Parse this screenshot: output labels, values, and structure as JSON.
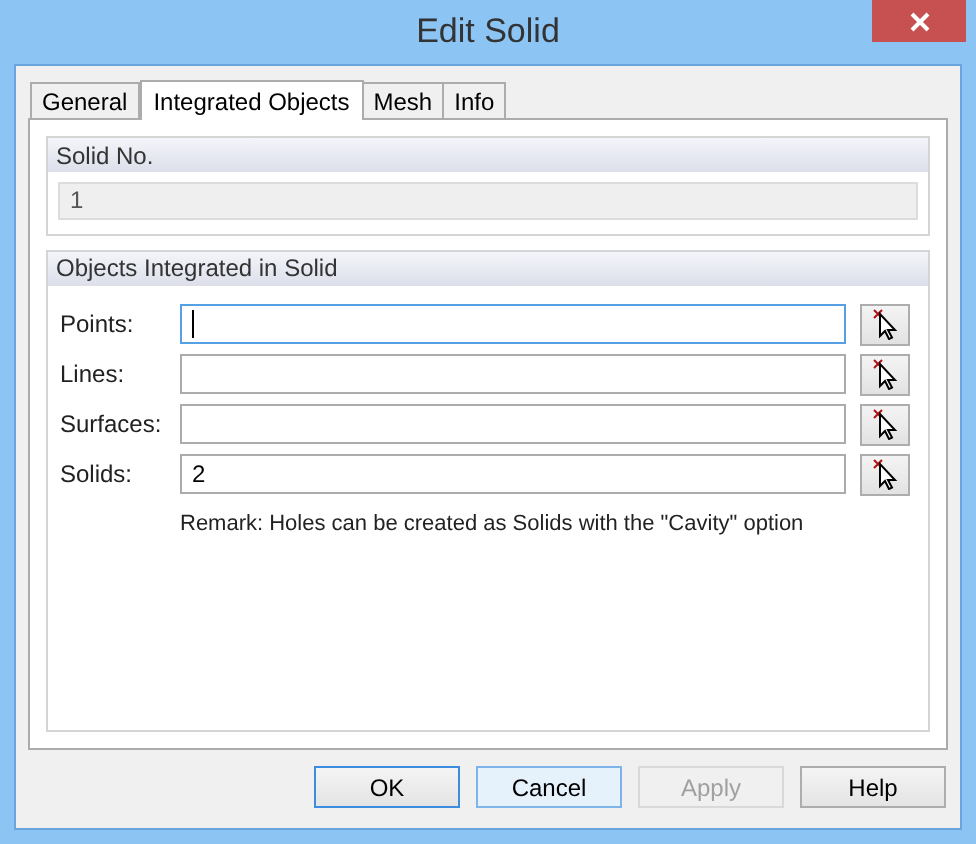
{
  "window": {
    "title": "Edit Solid"
  },
  "tabs": [
    {
      "label": "General",
      "selected": false
    },
    {
      "label": "Integrated Objects",
      "selected": true
    },
    {
      "label": "Mesh",
      "selected": false
    },
    {
      "label": "Info",
      "selected": false
    }
  ],
  "solid_no": {
    "heading": "Solid No.",
    "value": "1"
  },
  "objects": {
    "heading": "Objects Integrated in Solid",
    "fields": [
      {
        "label": "Points:",
        "focused": true
      },
      {
        "label": "Lines:",
        "focused": false
      },
      {
        "label": "Surfaces:",
        "focused": false
      },
      {
        "label": "Solids:",
        "value": "2",
        "focused": false
      }
    ],
    "remark": "Remark: Holes can be created as Solids with the \"Cavity\" option"
  },
  "buttons": [
    {
      "label": "OK",
      "kind": "default",
      "disabled": false
    },
    {
      "label": "Cancel",
      "kind": "hover",
      "disabled": false
    },
    {
      "label": "Apply",
      "disabled": true
    },
    {
      "label": "Help",
      "kind": "normal",
      "disabled": false
    }
  ]
}
